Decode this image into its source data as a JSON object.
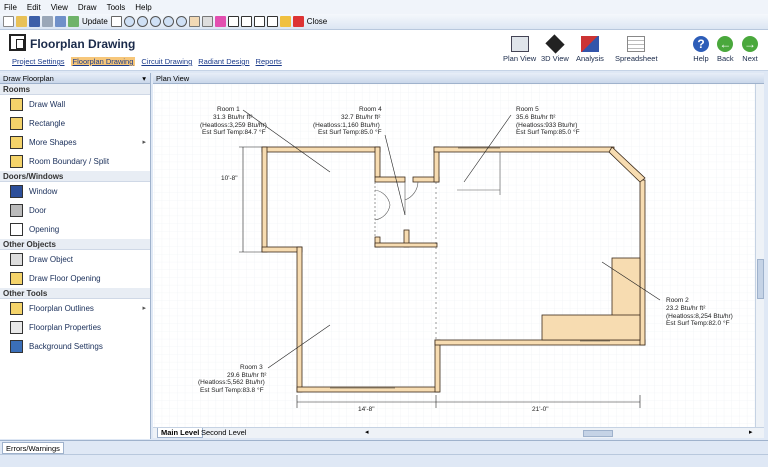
{
  "menu": [
    "File",
    "Edit",
    "View",
    "Draw",
    "Tools",
    "Help"
  ],
  "toolbar": {
    "update_label": "Update",
    "close_label": "Close"
  },
  "app": {
    "title": "Floorplan Drawing"
  },
  "ribbon_tabs": [
    "Project Settings",
    "Floorplan Drawing",
    "Circuit Drawing",
    "Radiant Design",
    "Reports"
  ],
  "ribbon_buttons": {
    "plan_view": "Plan View",
    "view_3d": "3D View",
    "analysis": "Analysis",
    "spreadsheet": "Spreadsheet",
    "help": "Help",
    "back": "Back",
    "next": "Next"
  },
  "left_panel": {
    "title": "Draw Floorplan",
    "sections": [
      {
        "title": "Rooms",
        "items": [
          "Draw Wall",
          "Rectangle",
          "More Shapes",
          "Room Boundary / Split"
        ]
      },
      {
        "title": "Doors/Windows",
        "items": [
          "Window",
          "Door",
          "Opening"
        ]
      },
      {
        "title": "Other Objects",
        "items": [
          "Draw Object",
          "Draw Floor Opening"
        ]
      },
      {
        "title": "Other Tools",
        "items": [
          "Floorplan Outlines",
          "Floorplan Properties",
          "Background Settings"
        ]
      }
    ]
  },
  "view": {
    "title": "Plan View"
  },
  "rooms": [
    {
      "name": "Room 1",
      "l1": "31.3 Btu/hr ft²",
      "l2": "(Heatloss:3,259 Btu/hr)",
      "l3": "Est Surf Temp:84.7 °F"
    },
    {
      "name": "Room 4",
      "l1": "32.7 Btu/hr ft²",
      "l2": "(Heatloss:1,160 Btu/hr)",
      "l3": "Est Surf Temp:85.0 °F"
    },
    {
      "name": "Room 5",
      "l1": "35.6 Btu/hr ft²",
      "l2": "(Heatloss:933 Btu/hr)",
      "l3": "Est Surf Temp:85.0 °F"
    },
    {
      "name": "Room 2",
      "l1": "23.2 Btu/hr ft²",
      "l2": "(Heatloss:8,254 Btu/hr)",
      "l3": "Est Surf Temp:82.0 °F"
    },
    {
      "name": "Room 3",
      "l1": "29.6 Btu/hr ft²",
      "l2": "(Heatloss:5,562 Btu/hr)",
      "l3": "Est Surf Temp:83.8 °F"
    }
  ],
  "dimensions": {
    "height": "10'-8\"",
    "width_left": "14'-8\"",
    "width_right": "21'-0\""
  },
  "level_tabs": [
    "Main Level",
    "Second Level"
  ],
  "bottom_tab": "Errors/Warnings"
}
